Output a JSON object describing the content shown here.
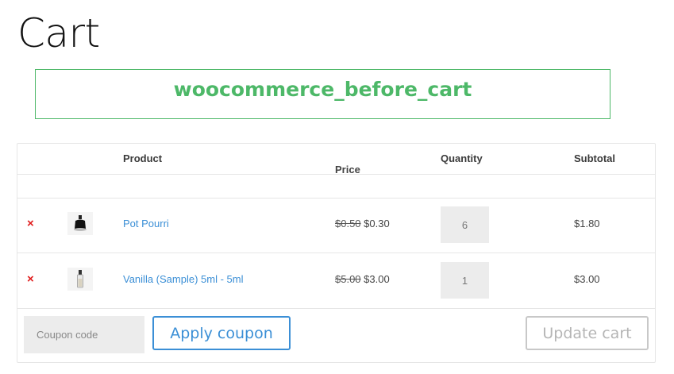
{
  "page": {
    "title": "Cart"
  },
  "hook": {
    "label": "woocommerce_before_cart"
  },
  "table": {
    "headers": {
      "product": "Product",
      "price": "Price",
      "quantity": "Quantity",
      "subtotal": "Subtotal"
    },
    "items": [
      {
        "remove": "×",
        "thumb_icon": "perfume-bottle-dark-icon",
        "name": "Pot Pourri",
        "old_price": "$0.50",
        "price": "$0.30",
        "quantity": "6",
        "subtotal": "$1.80"
      },
      {
        "remove": "×",
        "thumb_icon": "sample-vial-icon",
        "name": "Vanilla (Sample) 5ml - 5ml",
        "old_price": "$5.00",
        "price": "$3.00",
        "quantity": "1",
        "subtotal": "$3.00"
      }
    ]
  },
  "actions": {
    "coupon_placeholder": "Coupon code",
    "apply_label": "Apply coupon",
    "update_label": "Update cart"
  },
  "colors": {
    "accent": "#3b8fd6",
    "hook_green": "#4db868",
    "remove_red": "#e01b1b"
  }
}
